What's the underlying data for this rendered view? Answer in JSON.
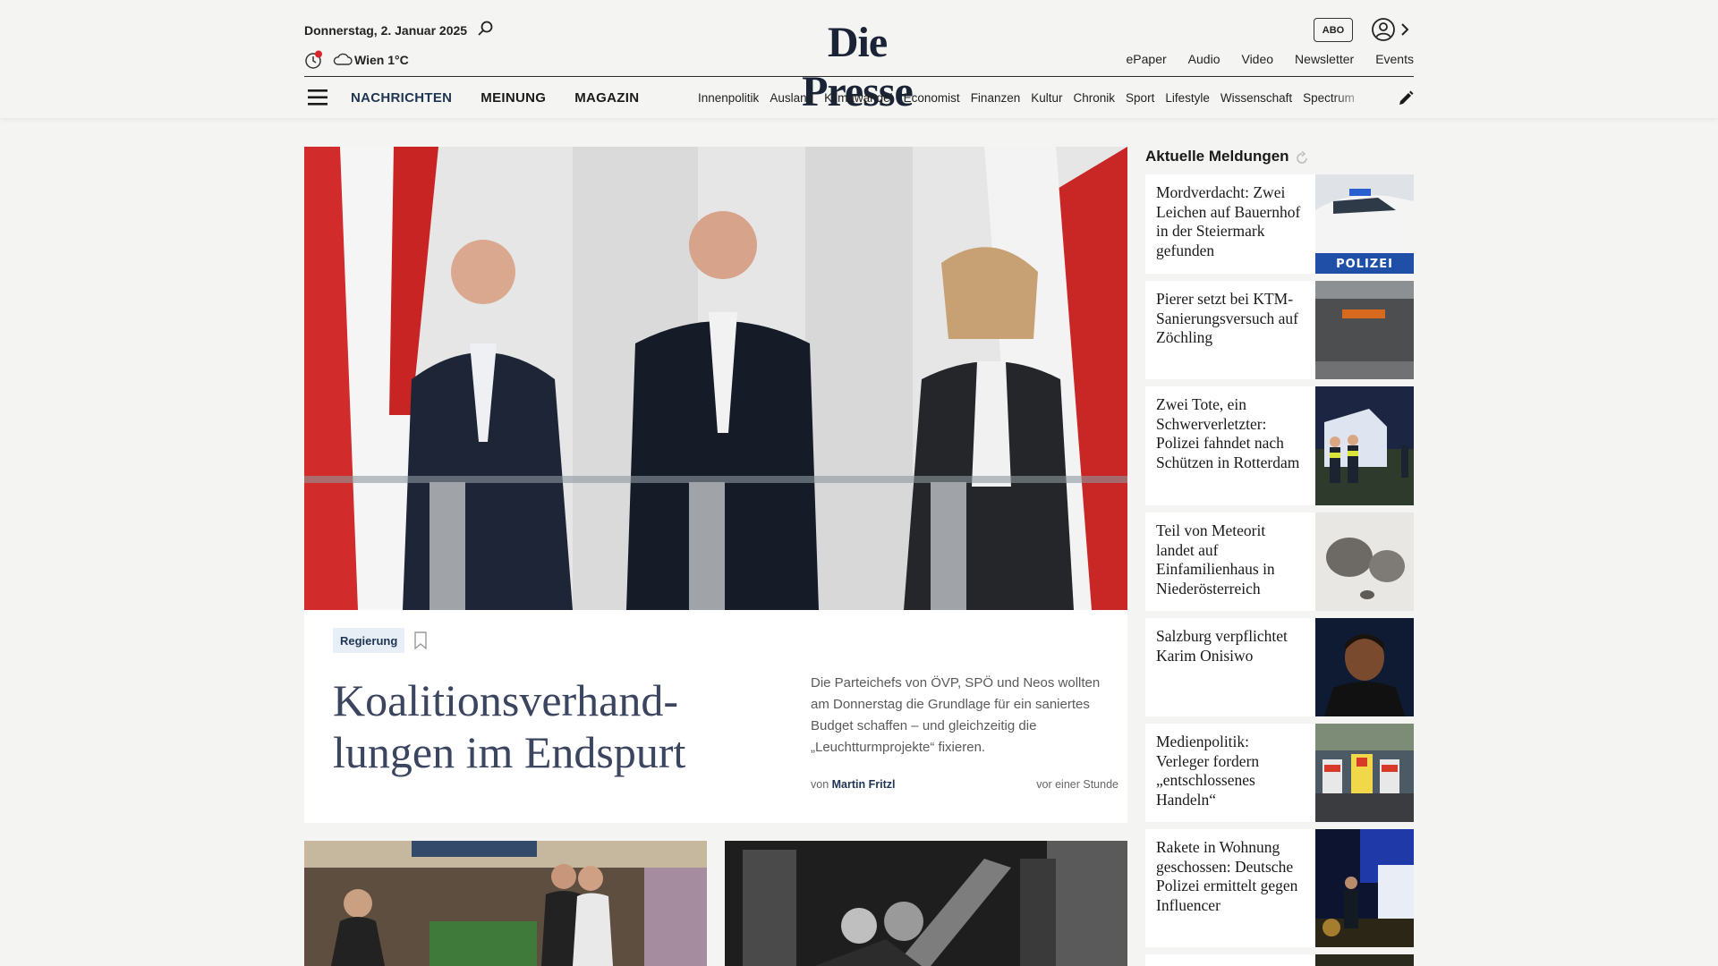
{
  "header": {
    "date": "Donnerstag, 2. Januar 2025",
    "weather": "Wien 1°C",
    "logo": "Die Presse",
    "abo_label": "ABO",
    "util_links": [
      "ePaper",
      "Audio",
      "Video",
      "Newsletter",
      "Events"
    ],
    "main_nav": [
      "NACHRICHTEN",
      "MEINUNG",
      "MAGAZIN"
    ],
    "categories": [
      "Innenpolitik",
      "Ausland",
      "Klimawandel",
      "Economist",
      "Finanzen",
      "Kultur",
      "Chronik",
      "Sport",
      "Lifestyle",
      "Wissenschaft",
      "Spectrum"
    ],
    "icons": {
      "search": "search-icon",
      "notifications": "notification-icon",
      "weather": "cloud-icon",
      "account": "account-icon",
      "menu": "menu-icon",
      "edit": "pencil-icon"
    }
  },
  "hero": {
    "tag": "Regierung",
    "title": "Koalitionsverhand-lungen im Endspurt",
    "teaser": "Die Parteichefs von ÖVP, SPÖ und Neos wollten am Donnerstag die Grundlage für ein saniertes Budget schaffen – und gleichzeitig die „Leuchtturmprojekte“ fixieren.",
    "byline_prefix": "von",
    "author": "Martin Fritzl",
    "time": "vor einer Stunde"
  },
  "sidebar": {
    "title": "Aktuelle Meldungen",
    "items": [
      {
        "headline": "Mordverdacht: Zwei Leichen auf Bauernhof in der Steiermark gefunden",
        "thumb_text": "POLIZEI"
      },
      {
        "headline": "Pierer setzt bei KTM-Sanierungsversuch auf Zöchling",
        "thumb_text": ""
      },
      {
        "headline": "Zwei Tote, ein Schwerverletzter: Polizei fahndet nach Schützen in Rotterdam",
        "thumb_text": ""
      },
      {
        "headline": "Teil von Meteorit landet auf Einfamilienhaus in Niederösterreich",
        "thumb_text": ""
      },
      {
        "headline": "Salzburg verpflichtet Karim Onisiwo",
        "thumb_text": ""
      },
      {
        "headline": "Medienpolitik: Verleger fordern „entschlossenes Handeln“",
        "thumb_text": ""
      },
      {
        "headline": "Rakete in Wohnung geschossen: Deutsche Polizei ermittelt gegen Influencer",
        "thumb_text": ""
      }
    ]
  },
  "colors": {
    "brand_navy": "#1a2436",
    "nav_blue": "#1e3553",
    "title_slate": "#3b4560",
    "notification_red": "#d9262c",
    "background": "#f4f4f2"
  }
}
